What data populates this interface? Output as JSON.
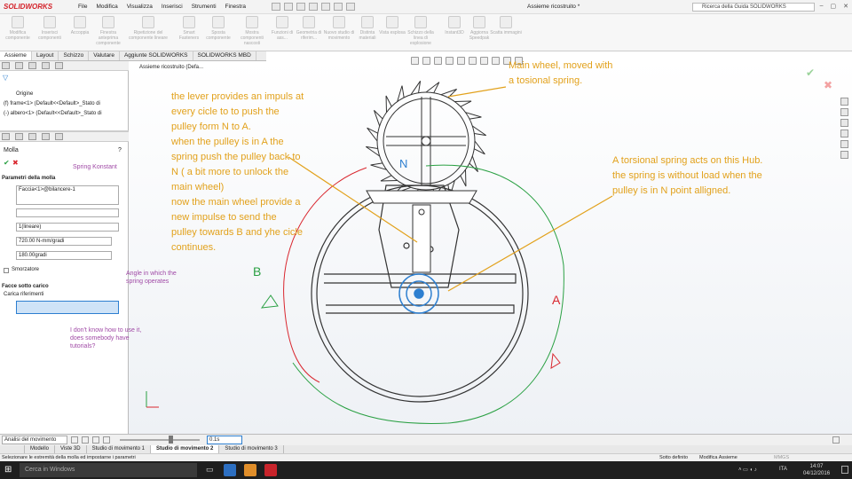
{
  "app": {
    "logo": "SOLIDWORKS",
    "doc_title": "Assieme ricostruito *"
  },
  "menu": [
    "File",
    "Modifica",
    "Visualizza",
    "Inserisci",
    "Strumenti",
    "Finestra"
  ],
  "search_placeholder": "Ricerca della Guida SOLIDWORKS",
  "ribbon": [
    "Modifica componente",
    "Inserisci componenti",
    "Accoppia",
    "Finestra anteprima componente",
    "Ripetizione del componente lineare",
    "Smart Fasteners",
    "Sposta componente",
    "Mostra componenti nascosti",
    "Funzioni di ass...",
    "Geometria di riferim...",
    "Nuovo studio di movimento",
    "Distinta materiali",
    "Vista esplosa",
    "Schizzo della linea di esplosione",
    "Instant3D",
    "Aggiorna Speedpak",
    "Scatta immagini"
  ],
  "cmd_tabs": [
    "Assieme",
    "Layout",
    "Schizzo",
    "Valutare",
    "Aggiunte SOLIDWORKS",
    "SOLIDWORKS MBD"
  ],
  "tree_root": "Assieme ricostruito (Defa...",
  "tree": [
    "Origine",
    "(f) frame<1> (Default<<Default>_Stato di",
    "(-) albero<1> (Default<<Default>_Stato di"
  ],
  "pm": {
    "title": "Molla",
    "section_params": "Parametri della molla",
    "face_field": "Faccia<1>@bilancere-1",
    "type_select": "1(lineare)",
    "k_value": "720.00 N-mm/gradi",
    "angle_value": "180.00gradi",
    "damper_label": "Smorzatore",
    "section_faces": "Facce sotto carico",
    "carry_label": "Carica riferimenti"
  },
  "annotations": {
    "lever_text": [
      "the lever provides an impuls at",
      "every cicle to to push the",
      "pulley form N to A.",
      "when the pulley is in A the",
      "spring push the pulley back to",
      "N ( a bit more to unlock the",
      "main wheel)",
      "now the main wheel provide a",
      "new impulse to send the",
      "pulley towards B and yhe cicle",
      "continues."
    ],
    "main_wheel": [
      "Main wheel, moved with",
      "a tosional spring."
    ],
    "torsional": [
      "A torsional spring acts on this Hub.",
      "the spring is without load when the",
      "pulley is in N point alligned."
    ],
    "spring_k": "Spring Konstant",
    "angle_note": [
      "Angle in which the",
      "spring operates"
    ],
    "help_note": [
      "I don't know how to use it,",
      "does somebody have",
      "tutorials?"
    ],
    "label_N": "N",
    "label_A": "A",
    "label_B": "B"
  },
  "motion": {
    "dropdown": "Analisi del movimento",
    "time_value": "0.1s"
  },
  "bottom_tabs": [
    "Modello",
    "Viste 3D",
    "Studio di movimento 1",
    "Studio di movimento 2",
    "Studio di movimento 3"
  ],
  "status": {
    "hint": "Selezionare le estremità della molla ed impostarne i parametri",
    "definition": "Sotto definito",
    "mode": "Modifica Assieme",
    "units": "MMGS"
  },
  "taskbar": {
    "search": "Cerca in Windows",
    "time": "14:07",
    "date": "04/12/2016",
    "lang": "ITA"
  },
  "colors": {
    "note_orange": "#e2a11b",
    "note_purple": "#a04aa6",
    "path_red": "#d9262e",
    "path_green": "#2aa043",
    "accent_blue": "#2d7fd0"
  }
}
